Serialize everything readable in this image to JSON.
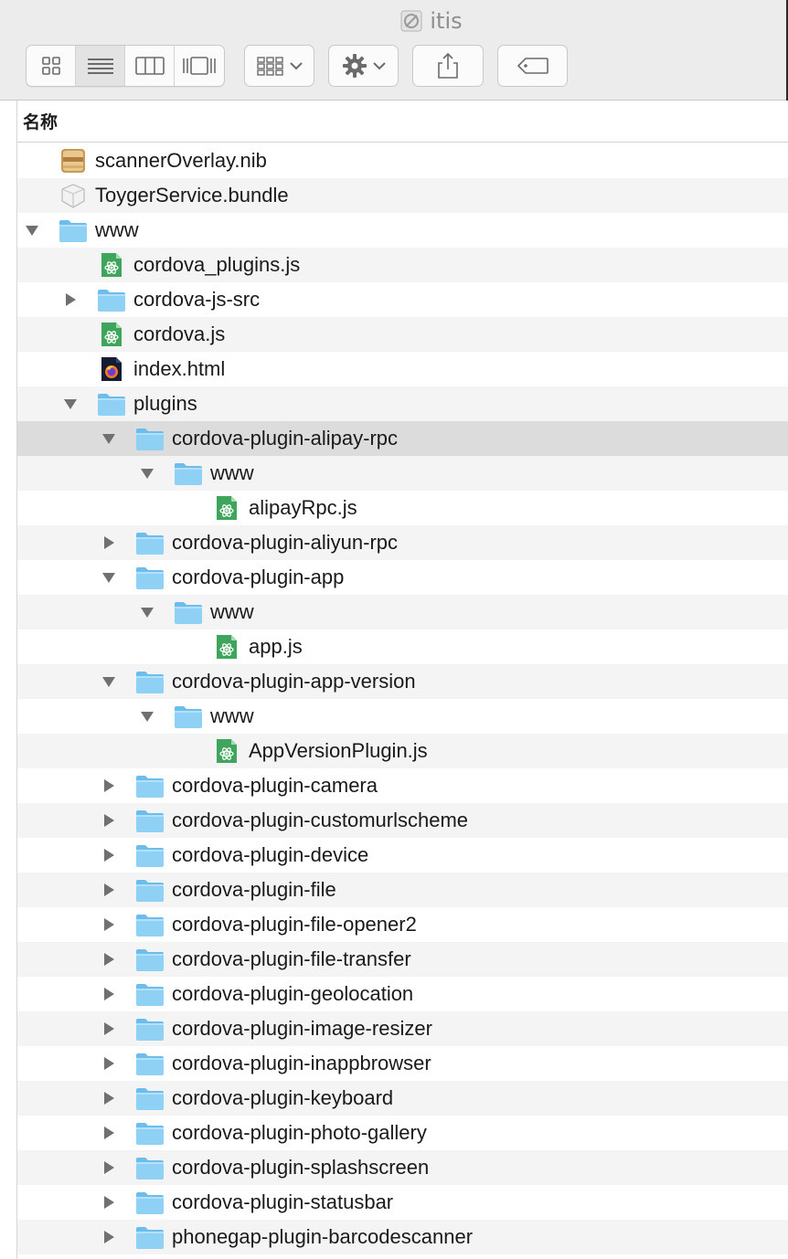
{
  "window": {
    "title": "itis"
  },
  "toolbar": {
    "view_buttons": [
      {
        "name": "icon-view",
        "icon": "grid-icon",
        "active": false
      },
      {
        "name": "list-view",
        "icon": "list-icon",
        "active": true
      },
      {
        "name": "column-view",
        "icon": "columns-icon",
        "active": false
      },
      {
        "name": "gallery-view",
        "icon": "gallery-icon",
        "active": false
      }
    ],
    "group_button": {
      "icon": "group-grid-icon"
    },
    "action_button": {
      "icon": "gear-icon"
    },
    "share_button": {
      "icon": "share-icon"
    },
    "tag_button": {
      "icon": "tag-icon"
    }
  },
  "list_header": {
    "name_column": "名称"
  },
  "rows": [
    {
      "label": "scannerOverlay.nib",
      "depth": 0,
      "disclosure": "none",
      "icon": "nib"
    },
    {
      "label": "ToygerService.bundle",
      "depth": 0,
      "disclosure": "none",
      "icon": "bundle"
    },
    {
      "label": "www",
      "depth": 0,
      "disclosure": "expanded",
      "icon": "folder"
    },
    {
      "label": "cordova_plugins.js",
      "depth": 1,
      "disclosure": "none",
      "icon": "js"
    },
    {
      "label": "cordova-js-src",
      "depth": 1,
      "disclosure": "collapsed",
      "icon": "folder"
    },
    {
      "label": "cordova.js",
      "depth": 1,
      "disclosure": "none",
      "icon": "js"
    },
    {
      "label": "index.html",
      "depth": 1,
      "disclosure": "none",
      "icon": "html"
    },
    {
      "label": "plugins",
      "depth": 1,
      "disclosure": "expanded",
      "icon": "folder"
    },
    {
      "label": "cordova-plugin-alipay-rpc",
      "depth": 2,
      "disclosure": "expanded",
      "icon": "folder",
      "selected": true
    },
    {
      "label": "www",
      "depth": 3,
      "disclosure": "expanded",
      "icon": "folder"
    },
    {
      "label": "alipayRpc.js",
      "depth": 4,
      "disclosure": "none",
      "icon": "js"
    },
    {
      "label": "cordova-plugin-aliyun-rpc",
      "depth": 2,
      "disclosure": "collapsed",
      "icon": "folder"
    },
    {
      "label": "cordova-plugin-app",
      "depth": 2,
      "disclosure": "expanded",
      "icon": "folder"
    },
    {
      "label": "www",
      "depth": 3,
      "disclosure": "expanded",
      "icon": "folder"
    },
    {
      "label": "app.js",
      "depth": 4,
      "disclosure": "none",
      "icon": "js"
    },
    {
      "label": "cordova-plugin-app-version",
      "depth": 2,
      "disclosure": "expanded",
      "icon": "folder"
    },
    {
      "label": "www",
      "depth": 3,
      "disclosure": "expanded",
      "icon": "folder"
    },
    {
      "label": "AppVersionPlugin.js",
      "depth": 4,
      "disclosure": "none",
      "icon": "js"
    },
    {
      "label": "cordova-plugin-camera",
      "depth": 2,
      "disclosure": "collapsed",
      "icon": "folder"
    },
    {
      "label": "cordova-plugin-customurlscheme",
      "depth": 2,
      "disclosure": "collapsed",
      "icon": "folder"
    },
    {
      "label": "cordova-plugin-device",
      "depth": 2,
      "disclosure": "collapsed",
      "icon": "folder"
    },
    {
      "label": "cordova-plugin-file",
      "depth": 2,
      "disclosure": "collapsed",
      "icon": "folder"
    },
    {
      "label": "cordova-plugin-file-opener2",
      "depth": 2,
      "disclosure": "collapsed",
      "icon": "folder"
    },
    {
      "label": "cordova-plugin-file-transfer",
      "depth": 2,
      "disclosure": "collapsed",
      "icon": "folder"
    },
    {
      "label": "cordova-plugin-geolocation",
      "depth": 2,
      "disclosure": "collapsed",
      "icon": "folder"
    },
    {
      "label": "cordova-plugin-image-resizer",
      "depth": 2,
      "disclosure": "collapsed",
      "icon": "folder"
    },
    {
      "label": "cordova-plugin-inappbrowser",
      "depth": 2,
      "disclosure": "collapsed",
      "icon": "folder"
    },
    {
      "label": "cordova-plugin-keyboard",
      "depth": 2,
      "disclosure": "collapsed",
      "icon": "folder"
    },
    {
      "label": "cordova-plugin-photo-gallery",
      "depth": 2,
      "disclosure": "collapsed",
      "icon": "folder"
    },
    {
      "label": "cordova-plugin-splashscreen",
      "depth": 2,
      "disclosure": "collapsed",
      "icon": "folder"
    },
    {
      "label": "cordova-plugin-statusbar",
      "depth": 2,
      "disclosure": "collapsed",
      "icon": "folder"
    },
    {
      "label": "phonegap-plugin-barcodescanner",
      "depth": 2,
      "disclosure": "collapsed",
      "icon": "folder"
    }
  ],
  "colors": {
    "folder": "#8fd0f5",
    "folder_dark": "#6cbdec",
    "js_green": "#3fa55c",
    "selected_row": "#dcdcdc",
    "alt_row": "#f4f4f4"
  }
}
